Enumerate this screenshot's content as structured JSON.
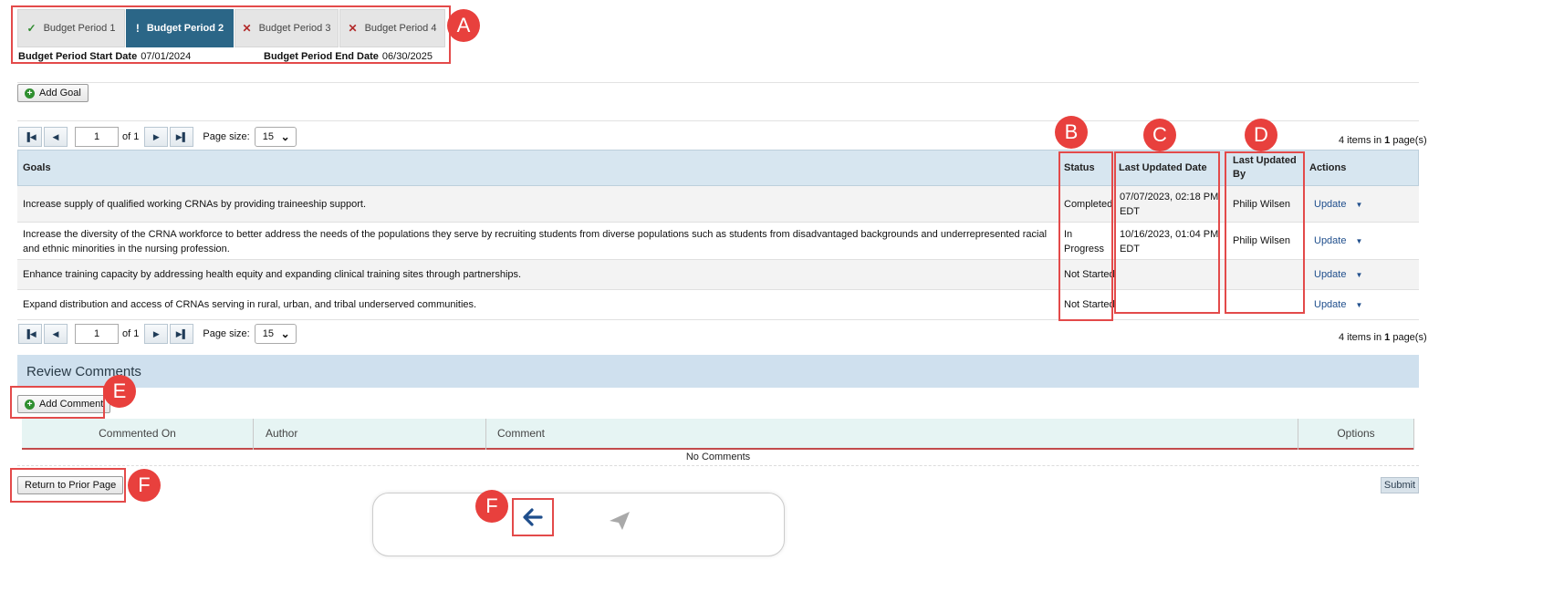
{
  "tabs": [
    {
      "label": "Budget Period 1",
      "state": "complete",
      "icon": "check-icon"
    },
    {
      "label": "Budget Period 2",
      "state": "active",
      "icon": "exclamation-icon"
    },
    {
      "label": "Budget Period 3",
      "state": "incomplete",
      "icon": "x-icon"
    },
    {
      "label": "Budget Period 4",
      "state": "incomplete",
      "icon": "x-icon"
    }
  ],
  "period": {
    "start_label": "Budget Period Start Date",
    "start_value": "07/01/2024",
    "end_label": "Budget Period End Date",
    "end_value": "06/30/2025"
  },
  "add_goal_label": "Add Goal",
  "pager": {
    "page": "1",
    "of_text": "of 1",
    "page_size_label": "Page size:",
    "page_size": "15",
    "info_prefix": "4 items in",
    "info_pages": "1",
    "info_suffix": "page(s)"
  },
  "grid": {
    "headers": {
      "goals": "Goals",
      "status": "Status",
      "last_updated_date": "Last Updated Date",
      "last_updated_by": "Last Updated By",
      "actions": "Actions"
    },
    "rows": [
      {
        "goal": "Increase supply of qualified working CRNAs by providing traineeship support.",
        "status": "Completed",
        "date": "07/07/2023, 02:18 PM EDT",
        "by": "Philip Wilsen",
        "action": "Update"
      },
      {
        "goal": "Increase the diversity of the CRNA workforce to better address the needs of the populations they serve by recruiting students from diverse populations such as students from disadvantaged backgrounds and underrepresented racial and ethnic minorities in the nursing profession.",
        "status": "In Progress",
        "date": "10/16/2023, 01:04 PM EDT",
        "by": "Philip Wilsen",
        "action": "Update"
      },
      {
        "goal": "Enhance training capacity by addressing health equity and expanding clinical training sites through partnerships.",
        "status": "Not Started",
        "date": "",
        "by": "",
        "action": "Update"
      },
      {
        "goal": "Expand distribution and access of CRNAs serving in rural, urban, and tribal underserved communities.",
        "status": "Not Started",
        "date": "",
        "by": "",
        "action": "Update"
      }
    ]
  },
  "review": {
    "title": "Review Comments",
    "add_comment_label": "Add Comment",
    "headers": {
      "commented_on": "Commented On",
      "author": "Author",
      "comment": "Comment",
      "options": "Options"
    },
    "empty_text": "No Comments"
  },
  "return_label": "Return to Prior Page",
  "submit_label": "Submit",
  "callouts": {
    "a": "A",
    "b": "B",
    "c": "C",
    "d": "D",
    "e": "E",
    "f1": "F",
    "f2": "F"
  },
  "colors": {
    "active_tab": "#2b6687",
    "callout": "#e8403d",
    "grid_header": "#d7e6f0"
  }
}
